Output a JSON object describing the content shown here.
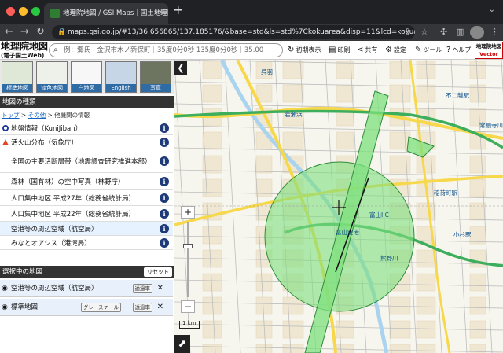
{
  "browser": {
    "tab_title": "地理院地図 / GSI Maps｜国土地理院",
    "tab_close": "✕",
    "new_tab": "+",
    "url": "maps.gsi.go.jp/#13/36.656865/137.185176/&base=std&ls=std%7Ckokuarea&disp=11&lcd=kokua..."
  },
  "header": {
    "logo_main": "地理院地図",
    "logo_sub": "(電子国土Web)",
    "search_placeholder": "例：郷氏｜金沢市木ノ新保町｜35度0分0秒 135度0分0秒｜35.00",
    "buttons": [
      {
        "label": "初期表示",
        "icon": "↻"
      },
      {
        "label": "印刷",
        "icon": "▤"
      },
      {
        "label": "共有",
        "icon": "⋖"
      },
      {
        "label": "設定",
        "icon": "⚙"
      },
      {
        "label": "ツール",
        "icon": "✎"
      },
      {
        "label": "ヘルプ",
        "icon": "?"
      }
    ],
    "brand_top": "地理院地図",
    "brand_bottom": "Vector"
  },
  "thumbs": [
    {
      "label": "標準地図",
      "color": "#dfe8d6"
    },
    {
      "label": "淡色地図",
      "color": "#eef0ea"
    },
    {
      "label": "白地図",
      "color": "#f7f7f7"
    },
    {
      "label": "English",
      "color": "#c7d6e6"
    },
    {
      "label": "写真",
      "color": "#6d7560"
    }
  ],
  "section_types": "地図の種類",
  "breadcrumb": {
    "top": "トップ",
    "other": "その他",
    "current": "他機関の情報",
    "sep": ">"
  },
  "layers": [
    {
      "label": "地盤情報（KuniJiban）",
      "marker": "circle"
    },
    {
      "label": "活火山分布（気象庁）",
      "marker": "triangle"
    },
    {
      "label": "全国の主要活断層帯（地震調査研究推進本部）",
      "marker": "none"
    },
    {
      "label": "森林（国有林）の空中写真（林野庁）",
      "marker": "none"
    },
    {
      "label": "人口集中地区 平成27年（総務省統計局）",
      "marker": "none"
    },
    {
      "label": "人口集中地区 平成22年（総務省統計局）",
      "marker": "none"
    },
    {
      "label": "空港等の周辺空域（航空局）",
      "marker": "none"
    },
    {
      "label": "みなとオアシス（港湾局）",
      "marker": "none"
    }
  ],
  "info_glyph": "i",
  "section_selected": "選択中の地図",
  "reset_label": "リセット",
  "selected": [
    {
      "label": "空港等の周辺空域（航空局）",
      "btn1": "透過率",
      "btn2": ""
    },
    {
      "label": "標準地図",
      "btn1": "透過率",
      "btn2": "グレースケール"
    }
  ],
  "map": {
    "labels": [
      "呉羽",
      "岩瀬浜",
      "富山空港",
      "富山I.C",
      "熊野川",
      "不二越駅",
      "小杉駅",
      "稲荷町駅",
      "常願寺川"
    ],
    "scale": "1 km",
    "zoom_in": "+",
    "zoom_out": "−",
    "toggle": "❮",
    "expand": "⬈"
  },
  "colors": {
    "airspace_fill": "#7ee07e",
    "airspace_stroke": "#2e8b3a",
    "road_main": "#f6d84a",
    "railway": "#3cae5c"
  }
}
